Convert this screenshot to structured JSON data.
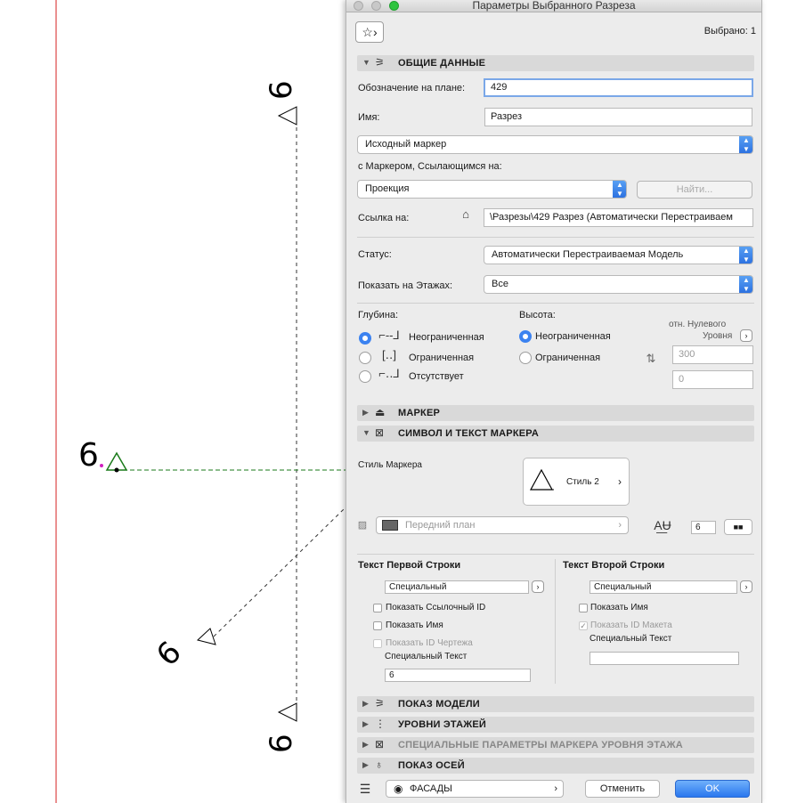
{
  "window": {
    "title": "Параметры Выбранного Разреза"
  },
  "header": {
    "favorites_icon": "star-icon",
    "selected_count": "Выбрано: 1"
  },
  "general": {
    "section_title": "ОБЩИЕ ДАННЫЕ",
    "plan_id_label": "Обозначение на плане:",
    "plan_id_value": "429",
    "name_label": "Имя:",
    "name_value": "Разрез",
    "marker_type": "Исходный маркер",
    "ref_label": "с Маркером, Ссылающимся на:",
    "ref_value": "Проекция",
    "find_button": "Найти...",
    "link_label": "Ссылка на:",
    "link_value": "\\Разрезы\\429 Разрез (Автоматически Перестраиваем",
    "status_label": "Статус:",
    "status_value": "Автоматически Перестраиваемая Модель",
    "stories_label": "Показать на Этажах:",
    "stories_value": "Все"
  },
  "depth": {
    "label": "Глубина:",
    "options": [
      "Неограниченная",
      "Ограниченная",
      "Отсутствует"
    ],
    "selected": 0
  },
  "height": {
    "label": "Высота:",
    "options": [
      "Неограниченная",
      "Ограниченная"
    ],
    "selected": 0,
    "ref_label_1": "отн. Нулевого",
    "ref_label_2": "Уровня",
    "top_value": "300",
    "bottom_value": "0"
  },
  "sections": {
    "marker": "МАРКЕР",
    "symbol_text": "СИМВОЛ И ТЕКСТ МАРКЕРА",
    "model_display": "ПОКАЗ МОДЕЛИ",
    "story_levels": "УРОВНИ ЭТАЖЕЙ",
    "story_marker_params": "СПЕЦИАЛЬНЫЕ ПАРАМЕТРЫ МАРКЕРА УРОВНЯ ЭТАЖА",
    "grid_display": "ПОКАЗ ОСЕЙ"
  },
  "symbol": {
    "style_label": "Стиль Маркера",
    "style_value": "Стиль 2",
    "pen_label": "Передний план",
    "font_size": "6"
  },
  "first_row": {
    "title": "Текст Первой Строки",
    "mode": "Специальный",
    "show_ref_id": "Показать Ссылочный ID",
    "show_name": "Показать Имя",
    "show_drawing_id": "Показать ID Чертежа",
    "custom_text_label": "Специальный Текст",
    "custom_text_value": "6"
  },
  "second_row": {
    "title": "Текст Второй Строки",
    "mode": "Специальный",
    "show_name": "Показать Имя",
    "show_layout_id": "Показать ID Макета",
    "custom_text_label": "Специальный Текст",
    "custom_text_value": ""
  },
  "footer": {
    "layer_icon": "layers-icon",
    "view_icon": "eye-icon",
    "layer_value": "ФАСАДЫ",
    "cancel": "Отменить",
    "ok": "OK"
  },
  "plan": {
    "marker_labels": [
      "6",
      "6",
      "6",
      "6"
    ]
  },
  "colors": {
    "accent": "#3b82f0",
    "marker_green": "#1a7a1a",
    "canvas_red": "#d42020"
  }
}
